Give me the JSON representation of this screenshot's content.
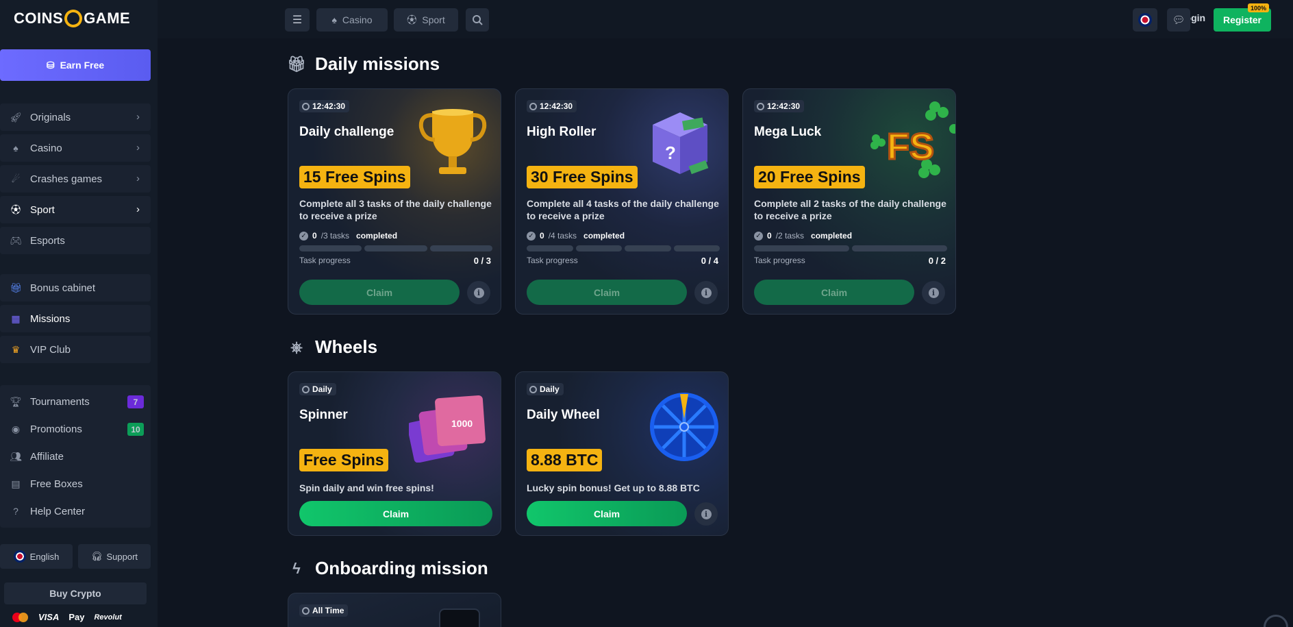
{
  "brand": {
    "logo_left": "COINS",
    "logo_right": "GAME"
  },
  "sidebar": {
    "earn_label": "Earn Free",
    "main_items": [
      {
        "label": "Originals",
        "icon": "rocket-icon"
      },
      {
        "label": "Casino",
        "icon": "spade-icon"
      },
      {
        "label": "Crashes games",
        "icon": "comet-icon"
      },
      {
        "label": "Sport",
        "icon": "ball-icon"
      },
      {
        "label": "Esports",
        "icon": "gamepad-icon"
      }
    ],
    "bonus_items": [
      {
        "label": "Bonus cabinet",
        "icon": "gift-icon"
      },
      {
        "label": "Missions",
        "icon": "grid-icon"
      },
      {
        "label": "VIP Club",
        "icon": "crown-icon"
      }
    ],
    "extra_items": [
      {
        "label": "Tournaments",
        "badge": "7",
        "icon": "trophy-icon"
      },
      {
        "label": "Promotions",
        "badge": "10",
        "icon": "promo-icon"
      },
      {
        "label": "Affiliate",
        "icon": "people-icon"
      },
      {
        "label": "Free Boxes",
        "icon": "box-icon"
      },
      {
        "label": "Help Center",
        "icon": "help-icon"
      }
    ],
    "language_label": "English",
    "support_label": "Support",
    "buy_crypto_label": "Buy Crypto",
    "payments": [
      "VISA",
      "Pay",
      "Revolut"
    ]
  },
  "topbar": {
    "casino_label": "Casino",
    "sport_label": "Sport",
    "login_label": "Login",
    "register_label": "Register",
    "register_badge": "100%"
  },
  "daily_missions": {
    "title": "Daily missions",
    "task_progress_label": "Task progress",
    "completed_label": "completed",
    "claim_label": "Claim",
    "cards": [
      {
        "timer": "12:42:30",
        "title": "Daily challenge",
        "prize": "15 Free Spins",
        "desc": "Complete all 3 tasks of the daily challenge to receive a prize",
        "done": "0",
        "total": "/3 tasks",
        "progress": "0 / 3"
      },
      {
        "timer": "12:42:30",
        "title": "High Roller",
        "prize": "30 Free Spins",
        "desc": "Complete all 4 tasks of the daily challenge to receive a prize",
        "done": "0",
        "total": "/4 tasks",
        "progress": "0 / 4"
      },
      {
        "timer": "12:42:30",
        "title": "Mega Luck",
        "prize": "20 Free Spins",
        "desc": "Complete all 2 tasks of the daily challenge to receive a prize",
        "done": "0",
        "total": "/2 tasks",
        "progress": "0 / 2",
        "art_text": "FS"
      }
    ]
  },
  "wheels": {
    "title": "Wheels",
    "cards": [
      {
        "tag": "Daily",
        "title": "Spinner",
        "prize": "Free Spins",
        "desc": "Spin daily and win free spins!",
        "claim": "Claim",
        "art_text": "1000"
      },
      {
        "tag": "Daily",
        "title": "Daily Wheel",
        "prize": "8.88 BTC",
        "desc": "Lucky spin bonus! Get up to 8.88 BTC",
        "claim": "Claim"
      }
    ]
  },
  "onboarding": {
    "title": "Onboarding mission",
    "card_tag": "All Time"
  },
  "colors": {
    "accent": "#f5b311",
    "green": "#0fb35f",
    "purple": "#6b6bff"
  }
}
